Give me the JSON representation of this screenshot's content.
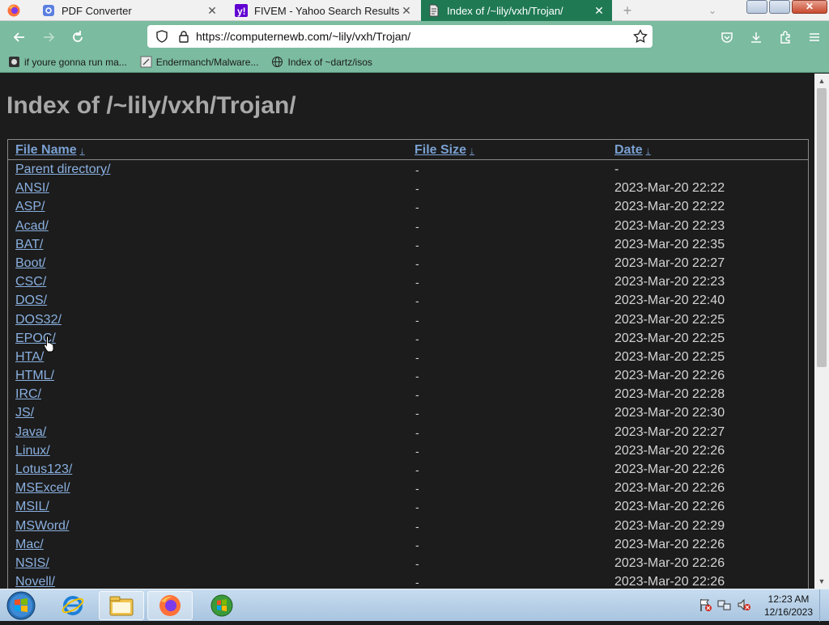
{
  "browser": {
    "tabs": [
      {
        "title": "PDF Converter",
        "icon": "pdf-converter-icon",
        "active": false
      },
      {
        "title": "FIVEM - Yahoo Search Results",
        "icon": "yahoo-icon",
        "active": false
      },
      {
        "title": "Index of /~lily/vxh/Trojan/",
        "icon": "page-icon",
        "active": true
      }
    ],
    "url": "https://computernewb.com/~lily/vxh/Trojan/",
    "bookmarks": [
      {
        "label": "if youre gonna run ma...",
        "icon": "bookmark-page-icon"
      },
      {
        "label": "Endermanch/Malware...",
        "icon": "github-icon"
      },
      {
        "label": "Index of ~dartz/isos",
        "icon": "globe-icon"
      }
    ],
    "colors": {
      "accent": "#7bbba0",
      "active_tab": "#1f7a54"
    }
  },
  "page": {
    "title": "Index of /~lily/vxh/Trojan/",
    "columns": {
      "name": "File Name",
      "size": "File Size",
      "date": "Date",
      "sort_indicator": "↓"
    },
    "rows": [
      {
        "name": "Parent directory/",
        "size": "-",
        "date": "-"
      },
      {
        "name": "ANSI/",
        "size": "-",
        "date": "2023-Mar-20 22:22"
      },
      {
        "name": "ASP/",
        "size": "-",
        "date": "2023-Mar-20 22:22"
      },
      {
        "name": "Acad/",
        "size": "-",
        "date": "2023-Mar-20 22:23"
      },
      {
        "name": "BAT/",
        "size": "-",
        "date": "2023-Mar-20 22:35"
      },
      {
        "name": "Boot/",
        "size": "-",
        "date": "2023-Mar-20 22:27"
      },
      {
        "name": "CSC/",
        "size": "-",
        "date": "2023-Mar-20 22:23"
      },
      {
        "name": "DOS/",
        "size": "-",
        "date": "2023-Mar-20 22:40"
      },
      {
        "name": "DOS32/",
        "size": "-",
        "date": "2023-Mar-20 22:25"
      },
      {
        "name": "EPOC/",
        "size": "-",
        "date": "2023-Mar-20 22:25"
      },
      {
        "name": "HTA/",
        "size": "-",
        "date": "2023-Mar-20 22:25"
      },
      {
        "name": "HTML/",
        "size": "-",
        "date": "2023-Mar-20 22:26"
      },
      {
        "name": "IRC/",
        "size": "-",
        "date": "2023-Mar-20 22:28"
      },
      {
        "name": "JS/",
        "size": "-",
        "date": "2023-Mar-20 22:30"
      },
      {
        "name": "Java/",
        "size": "-",
        "date": "2023-Mar-20 22:27"
      },
      {
        "name": "Linux/",
        "size": "-",
        "date": "2023-Mar-20 22:26"
      },
      {
        "name": "Lotus123/",
        "size": "-",
        "date": "2023-Mar-20 22:26"
      },
      {
        "name": "MSExcel/",
        "size": "-",
        "date": "2023-Mar-20 22:26"
      },
      {
        "name": "MSIL/",
        "size": "-",
        "date": "2023-Mar-20 22:26"
      },
      {
        "name": "MSWord/",
        "size": "-",
        "date": "2023-Mar-20 22:29"
      },
      {
        "name": "Mac/",
        "size": "-",
        "date": "2023-Mar-20 22:26"
      },
      {
        "name": "NSIS/",
        "size": "-",
        "date": "2023-Mar-20 22:26"
      },
      {
        "name": "Novell/",
        "size": "-",
        "date": "2023-Mar-20 22:26"
      }
    ]
  },
  "taskbar": {
    "apps": [
      {
        "name": "internet-explorer-icon",
        "active": false
      },
      {
        "name": "windows-explorer-icon",
        "active": true
      },
      {
        "name": "firefox-icon",
        "active": true
      },
      {
        "name": "windows-media-center-icon",
        "active": false
      }
    ],
    "clock": {
      "time": "12:23 AM",
      "date": "12/16/2023"
    }
  }
}
